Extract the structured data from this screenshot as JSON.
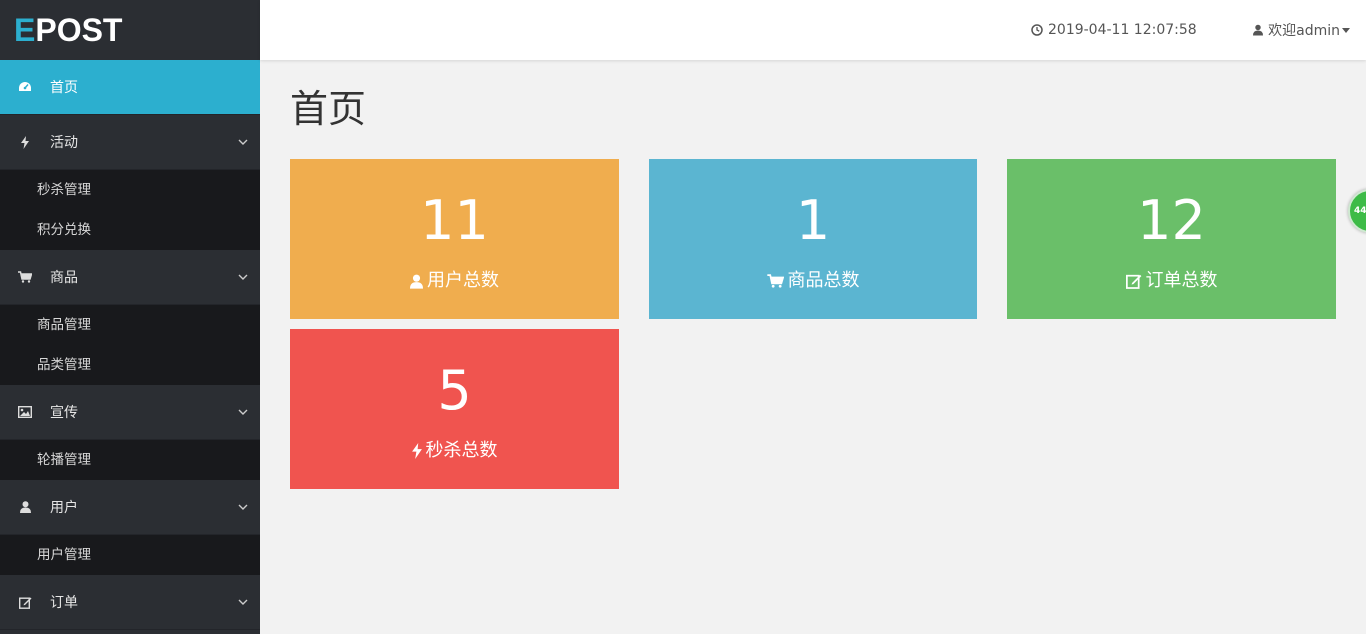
{
  "logo": {
    "first": "E",
    "rest": "POST"
  },
  "sidebar": {
    "home": {
      "label": "首页"
    },
    "activity": {
      "label": "活动",
      "subs": [
        "秒杀管理",
        "积分兑换"
      ]
    },
    "goods": {
      "label": "商品",
      "subs": [
        "商品管理",
        "品类管理"
      ]
    },
    "promo": {
      "label": "宣传",
      "subs": [
        "轮播管理"
      ]
    },
    "users": {
      "label": "用户",
      "subs": [
        "用户管理"
      ]
    },
    "orders": {
      "label": "订单"
    }
  },
  "header": {
    "datetime": "2019-04-11 12:07:58",
    "welcome": "欢迎admin"
  },
  "page": {
    "title": "首页"
  },
  "cards": [
    {
      "value": "11",
      "label": "用户总数",
      "icon": "user-icon",
      "color": "#f0ad4e"
    },
    {
      "value": "1",
      "label": "商品总数",
      "icon": "cart-icon",
      "color": "#5bb5d1"
    },
    {
      "value": "12",
      "label": "订单总数",
      "icon": "edit-icon",
      "color": "#6abf69"
    },
    {
      "value": "5",
      "label": "秒杀总数",
      "icon": "bolt-icon",
      "color": "#f0544f"
    }
  ],
  "floating_badge": {
    "text": "44"
  },
  "colors": {
    "accent": "#2cafcf",
    "sidebar_bg": "#2b2e33",
    "submenu_bg": "#18191c"
  }
}
